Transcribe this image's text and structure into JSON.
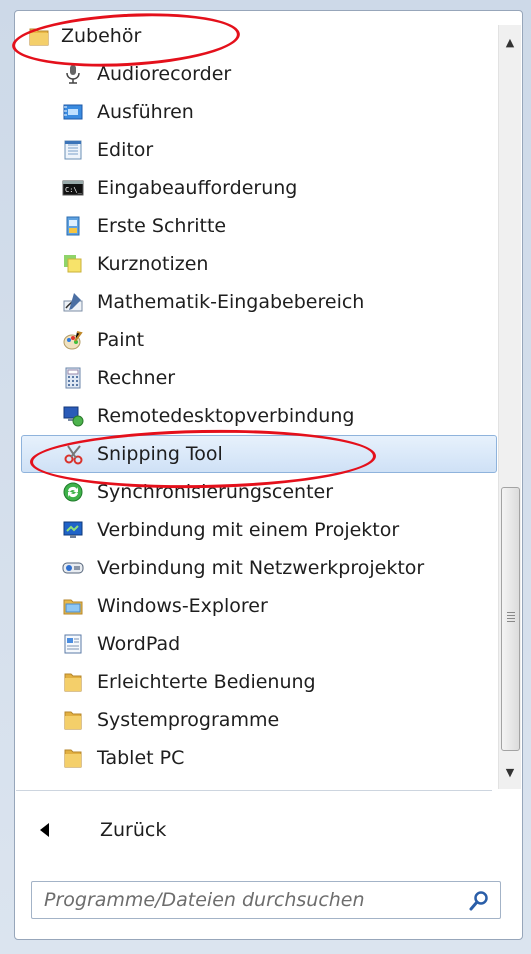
{
  "menu": {
    "root": {
      "label": "Zubehör",
      "icon": "folder-icon"
    },
    "items": [
      {
        "label": "Audiorecorder",
        "icon": "microphone-icon"
      },
      {
        "label": "Ausführen",
        "icon": "run-icon"
      },
      {
        "label": "Editor",
        "icon": "notepad-icon"
      },
      {
        "label": "Eingabeaufforderung",
        "icon": "command-prompt-icon"
      },
      {
        "label": "Erste Schritte",
        "icon": "getting-started-icon"
      },
      {
        "label": "Kurznotizen",
        "icon": "sticky-notes-icon"
      },
      {
        "label": "Mathematik-Eingabebereich",
        "icon": "math-input-icon"
      },
      {
        "label": "Paint",
        "icon": "paint-palette-icon"
      },
      {
        "label": "Rechner",
        "icon": "calculator-icon"
      },
      {
        "label": "Remotedesktopverbindung",
        "icon": "remote-desktop-icon"
      },
      {
        "label": "Snipping Tool",
        "icon": "scissors-icon",
        "selected": true
      },
      {
        "label": "Synchronisierungscenter",
        "icon": "sync-center-icon"
      },
      {
        "label": "Verbindung mit einem Projektor",
        "icon": "projector-icon"
      },
      {
        "label": "Verbindung mit Netzwerkprojektor",
        "icon": "network-projector-icon"
      },
      {
        "label": "Windows-Explorer",
        "icon": "explorer-folder-icon"
      },
      {
        "label": "WordPad",
        "icon": "wordpad-icon"
      },
      {
        "label": "Erleichterte Bedienung",
        "icon": "folder-icon"
      },
      {
        "label": "Systemprogramme",
        "icon": "folder-icon"
      },
      {
        "label": "Tablet PC",
        "icon": "folder-icon"
      }
    ]
  },
  "back": {
    "label": "Zurück",
    "icon": "back-triangle-icon"
  },
  "search": {
    "placeholder": "Programme/Dateien durchsuchen",
    "value": "",
    "icon": "search-icon"
  },
  "annotations": {
    "color": "#e4101b"
  },
  "colors": {
    "selection": "#cfe1f6",
    "selection_border": "#8fb3dc"
  }
}
